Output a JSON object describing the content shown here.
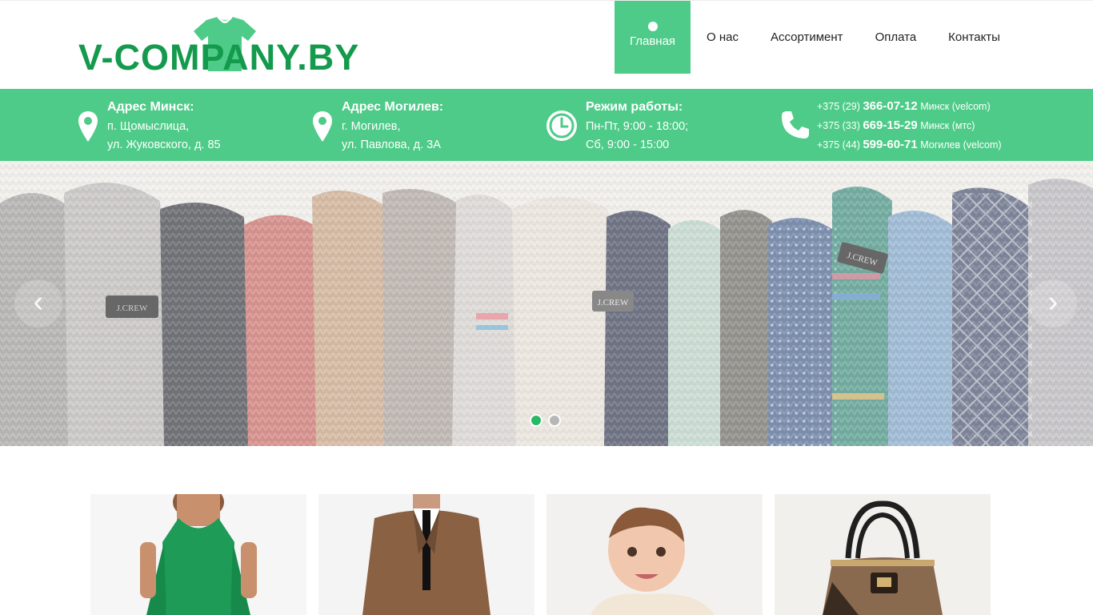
{
  "brand": {
    "logo_text": "V-COMPANY.BY",
    "color_primary": "#149a4d",
    "color_accent": "#4ecb88"
  },
  "nav": {
    "items": [
      {
        "label": "Главная",
        "active": true
      },
      {
        "label": "О нас",
        "active": false
      },
      {
        "label": "Ассортимент",
        "active": false
      },
      {
        "label": "Оплата",
        "active": false
      },
      {
        "label": "Контакты",
        "active": false
      }
    ]
  },
  "info": {
    "minsk": {
      "icon": "map-pin-icon",
      "title": "Адрес Минск:",
      "line1": "п. Щомыслица,",
      "line2": "ул. Жуковского, д. 85"
    },
    "mogilev": {
      "icon": "map-pin-icon",
      "title": "Адрес Могилев:",
      "line1": "г. Могилев,",
      "line2": "ул. Павлова, д. 3А"
    },
    "hours": {
      "icon": "clock-icon",
      "title": "Режим работы:",
      "line1": "Пн-Пт, 9:00 - 18:00;",
      "line2": "Сб, 9:00 - 15:00"
    },
    "phones": {
      "icon": "phone-icon",
      "rows": [
        {
          "code": "+375 (29)",
          "number": "366-07-12",
          "note": "Минск (velcom)"
        },
        {
          "code": "+375 (33)",
          "number": "669-15-29",
          "note": "Минск (мтс)"
        },
        {
          "code": "+375 (44)",
          "number": "599-60-71",
          "note": "Могилев (velcom)"
        }
      ]
    }
  },
  "slider": {
    "image": "knitted-sweaters-photo",
    "prev_icon": "chevron-left-icon",
    "next_icon": "chevron-right-icon",
    "prev_glyph": "‹",
    "next_glyph": "›",
    "slide_count": 2,
    "active_slide": 1,
    "tags": [
      "J.CREW",
      "J.CREW",
      "J.CREW"
    ]
  },
  "categories": [
    {
      "image": "green-dress-photo"
    },
    {
      "image": "mens-suit-photo"
    },
    {
      "image": "baby-photo"
    },
    {
      "image": "handbag-photo"
    }
  ]
}
